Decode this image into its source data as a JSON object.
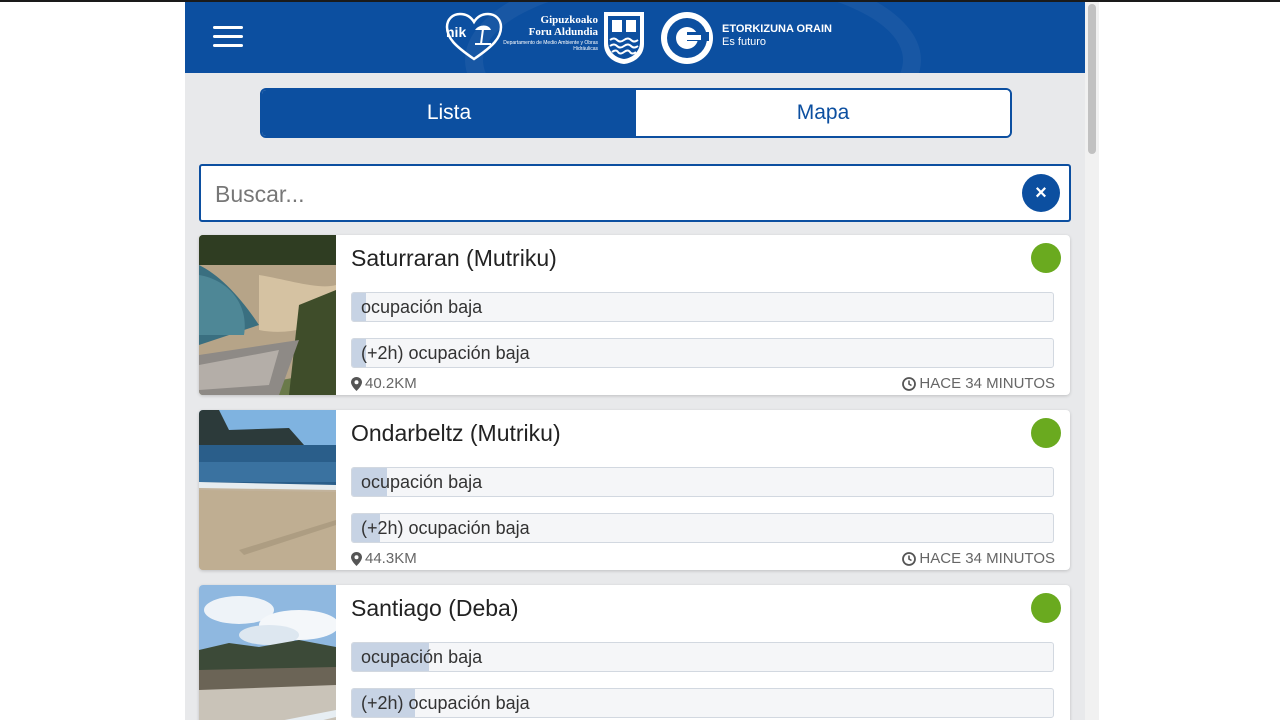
{
  "header": {
    "org_line1": "Gipuzkoako",
    "org_line2": "Foru Aldundia",
    "org_dept": "Departamento de Medio Ambiente y Obras Hidráulicas",
    "nik_label": "nik",
    "slogan_title": "ETORKIZUNA ORAIN",
    "slogan_sub": "Es futuro",
    "brand_color": "#0c4fa0"
  },
  "tabs": [
    {
      "label": "Lista",
      "active": true
    },
    {
      "label": "Mapa",
      "active": false
    }
  ],
  "search": {
    "placeholder": "Buscar...",
    "value": "",
    "clear_label": "×"
  },
  "beaches": [
    {
      "name": "Saturraran (Mutriku)",
      "status_color": "#6aaa1f",
      "occupancy_now": "ocupación baja",
      "occupancy_now_level": 0.02,
      "occupancy_2h": "(+2h) ocupación baja",
      "occupancy_2h_level": 0.02,
      "distance": "40.2KM",
      "updated": "HACE 34 MINUTOS"
    },
    {
      "name": "Ondarbeltz (Mutriku)",
      "status_color": "#6aaa1f",
      "occupancy_now": "ocupación baja",
      "occupancy_now_level": 0.05,
      "occupancy_2h": "(+2h) ocupación baja",
      "occupancy_2h_level": 0.04,
      "distance": "44.3KM",
      "updated": "HACE 34 MINUTOS"
    },
    {
      "name": "Santiago (Deba)",
      "status_color": "#6aaa1f",
      "occupancy_now": "ocupación baja",
      "occupancy_now_level": 0.11,
      "occupancy_2h": "(+2h) ocupación baja",
      "occupancy_2h_level": 0.09
    }
  ]
}
